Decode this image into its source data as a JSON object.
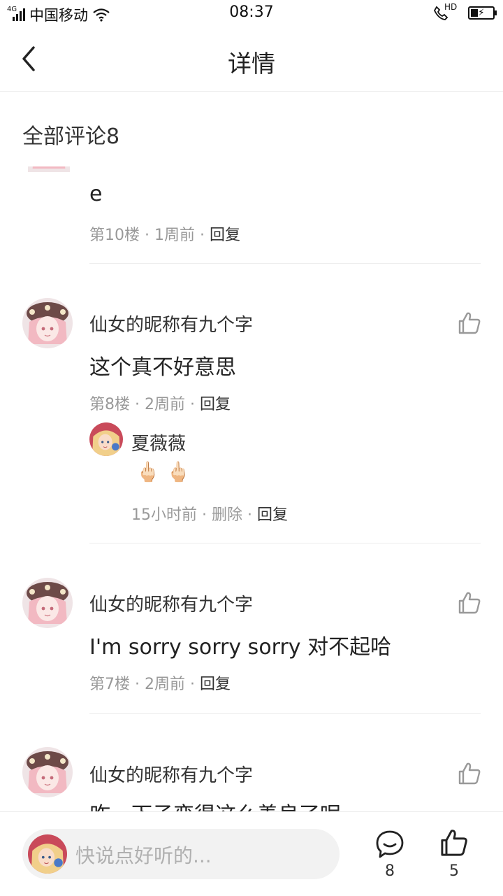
{
  "status_bar": {
    "network": "4G",
    "carrier": "中国移动",
    "time": "08:37",
    "hd_label": "HD",
    "battery_level": 0.35
  },
  "nav": {
    "title": "详情",
    "back_icon": "chevron-left-icon"
  },
  "comments_header": "全部评论8",
  "comments": [
    {
      "text": "e",
      "floor": "第10楼",
      "time": "1周前",
      "reply_label": "回复"
    },
    {
      "username": "仙女的昵称有九个字",
      "text": "这个真不好意思",
      "floor": "第8楼",
      "time": "2周前",
      "reply_label": "回复",
      "reply": {
        "username": "夏薇薇",
        "emoji": "🖕🏻 🖕🏻",
        "time": "15小时前",
        "delete_label": "删除",
        "reply_label": "回复"
      }
    },
    {
      "username": "仙女的昵称有九个字",
      "text": "I'm sorry sorry sorry 对不起哈",
      "floor": "第7楼",
      "time": "2周前",
      "reply_label": "回复"
    },
    {
      "username": "仙女的昵称有九个字",
      "text": "咋一下子变得这么善良了呢"
    }
  ],
  "separator": "·",
  "bottom_bar": {
    "placeholder": "快说点好听的...",
    "comment_count": "8",
    "like_count": "5"
  },
  "colors": {
    "text_primary": "#222222",
    "text_meta": "#999999",
    "divider": "#ececec",
    "input_bg": "#f2f2f2"
  }
}
